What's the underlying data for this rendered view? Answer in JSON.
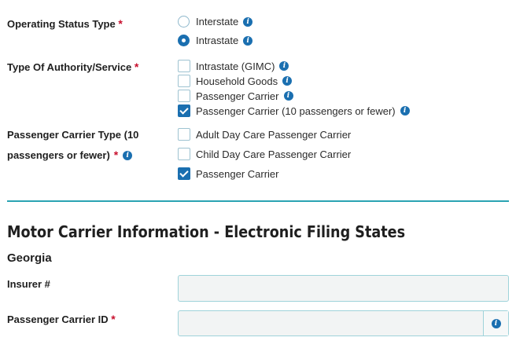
{
  "operating_status": {
    "label": "Operating Status Type",
    "required": "*",
    "options": [
      {
        "label": "Interstate",
        "checked": false
      },
      {
        "label": "Intrastate",
        "checked": true
      }
    ]
  },
  "authority": {
    "label": "Type Of Authority/Service",
    "required": "*",
    "options": [
      {
        "label": "Intrastate (GIMC)",
        "checked": false
      },
      {
        "label": "Household Goods",
        "checked": false
      },
      {
        "label": "Passenger Carrier",
        "checked": false
      },
      {
        "label": "Passenger Carrier (10 passengers or fewer)",
        "checked": true
      }
    ]
  },
  "passenger_type": {
    "label_line1": "Passenger Carrier Type (10",
    "label_line2": "passengers or fewer)",
    "required": "*",
    "options": [
      {
        "label": "Adult Day Care Passenger Carrier",
        "checked": false
      },
      {
        "label": "Child Day Care Passenger Carrier",
        "checked": false
      },
      {
        "label": "Passenger Carrier",
        "checked": true
      }
    ]
  },
  "section": {
    "title": "Motor Carrier Information - Electronic Filing States",
    "state": "Georgia"
  },
  "fields": {
    "insurer": {
      "label": "Insurer #",
      "value": ""
    },
    "passenger_carrier_id": {
      "label": "Passenger Carrier ID",
      "required": "*",
      "value": ""
    }
  },
  "icons": {
    "info": "i"
  },
  "colors": {
    "accent": "#1a6fb0",
    "divider": "#2aa3b3",
    "required": "#c8102e"
  }
}
